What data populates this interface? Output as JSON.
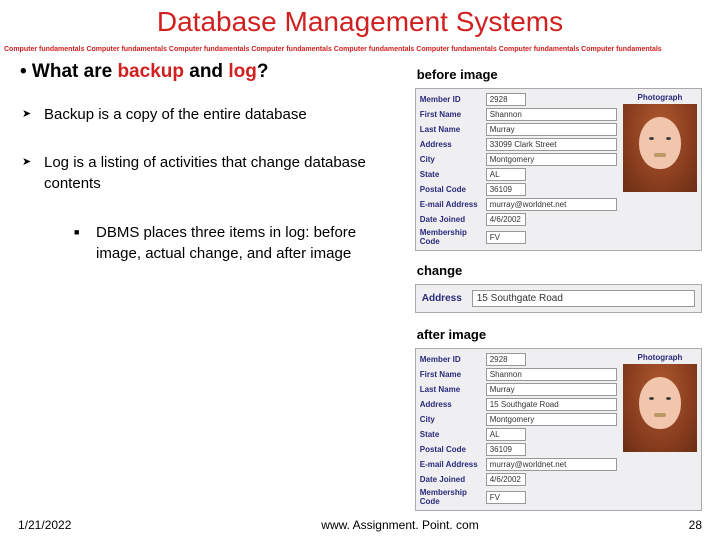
{
  "title": "Database Management Systems",
  "band_phrase": "Computer fundamentals",
  "question": {
    "prefix": "• What are ",
    "word1": "backup",
    "mid": " and ",
    "word2": "log",
    "suffix": "?"
  },
  "labels": {
    "before": "before image",
    "change": "change",
    "after": "after image"
  },
  "bullets": {
    "b1": "Backup is a copy of the entire database",
    "b2": "Log is a listing of activities that change database contents",
    "sub1": "DBMS places three items in log: before image, actual change, and after image"
  },
  "form_fields": {
    "member_id": "Member ID",
    "first_name": "First Name",
    "last_name": "Last Name",
    "address": "Address",
    "city": "City",
    "state": "State",
    "postal_code": "Postal Code",
    "email": "E-mail Address",
    "date_joined": "Date Joined",
    "membership_code": "Membership Code",
    "photograph": "Photograph"
  },
  "before_values": {
    "member_id": "2928",
    "first_name": "Shannon",
    "last_name": "Murray",
    "address": "33099 Clark Street",
    "city": "Montgomery",
    "state": "AL",
    "postal_code": "36109",
    "email": "murray@worldnet.net",
    "date_joined": "4/6/2002",
    "membership_code": "FV"
  },
  "change_values": {
    "address_label": "Address",
    "address": "15 Southgate Road"
  },
  "after_values": {
    "member_id": "2928",
    "first_name": "Shannon",
    "last_name": "Murray",
    "address": "15 Southgate Road",
    "city": "Montgomery",
    "state": "AL",
    "postal_code": "36109",
    "email": "murray@worldnet.net",
    "date_joined": "4/6/2002",
    "membership_code": "FV"
  },
  "footer": {
    "date": "1/21/2022",
    "site": "www. Assignment. Point. com",
    "page": "28"
  }
}
